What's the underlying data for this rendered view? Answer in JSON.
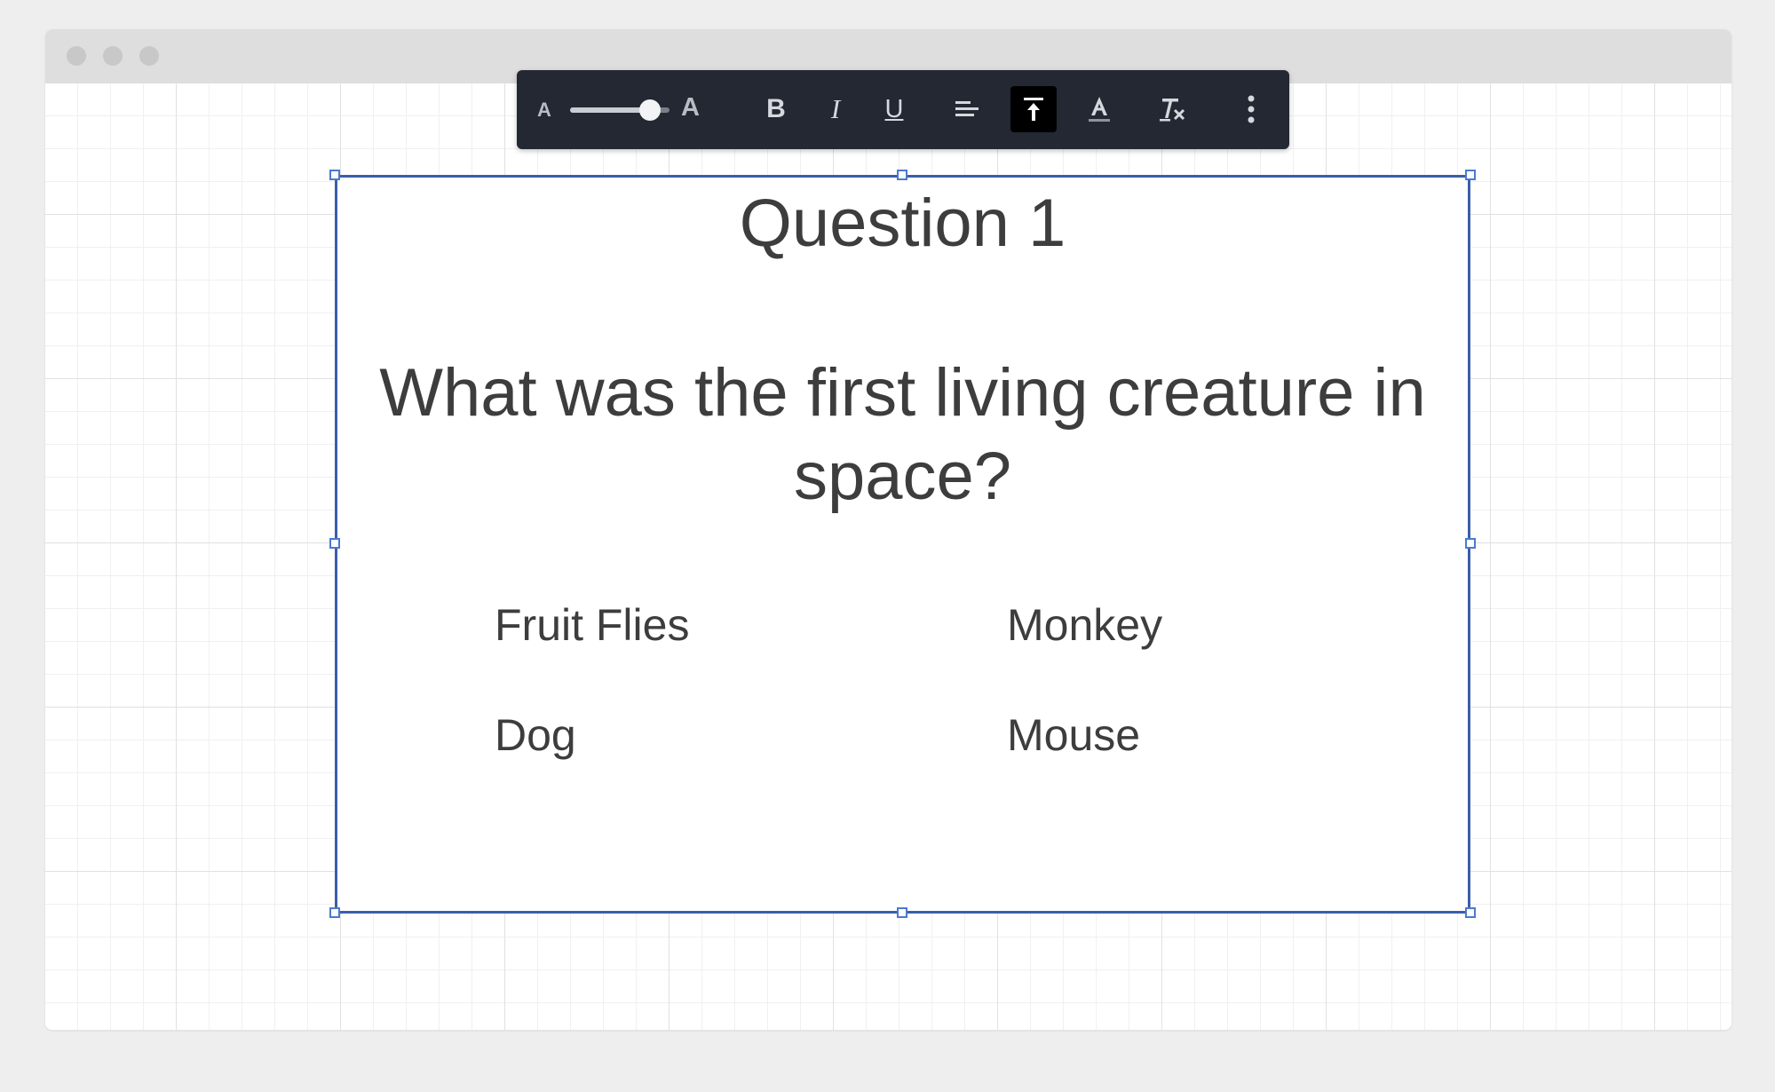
{
  "toolbar": {
    "font_size_small": "A",
    "font_size_large": "A",
    "font_size_slider_value": 0.8,
    "bold": "B",
    "italic": "I",
    "underline": "U",
    "icons": [
      "align-left-icon",
      "vertical-align-top-icon",
      "text-color-icon",
      "clear-format-icon",
      "more-vertical-icon"
    ],
    "active_tool": "vertical-align-top"
  },
  "slide": {
    "title": "Question 1",
    "question": "What was the first living creature in space?",
    "options": [
      "Fruit Flies",
      "Monkey",
      "Dog",
      "Mouse"
    ]
  },
  "colors": {
    "toolbar_bg": "#242832",
    "selection_border": "#3a5ea8",
    "text": "#3d3d3d"
  }
}
